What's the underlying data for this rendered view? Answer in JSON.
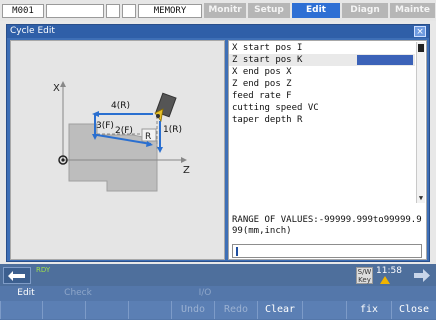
{
  "topbar": {
    "program": "M001",
    "mode": "MEMORY",
    "tabs": [
      {
        "label": "Monitr",
        "active": false
      },
      {
        "label": "Setup",
        "active": false
      },
      {
        "label": "Edit",
        "active": true
      },
      {
        "label": "Diagn",
        "active": false
      },
      {
        "label": "Mainte",
        "active": false
      }
    ]
  },
  "window": {
    "title": "Cycle Edit",
    "close_glyph": "×"
  },
  "diagram": {
    "axis_x": "X",
    "axis_z": "Z",
    "label_4r": "4(R)",
    "label_3f": "3(F)",
    "label_2f": "2(F)",
    "label_1r": "1(R)",
    "label_r": "R"
  },
  "params": [
    {
      "label": "X start pos  I",
      "selected": false
    },
    {
      "label": "Z start pos  K",
      "selected": true
    },
    {
      "label": "X end pos  X",
      "selected": false
    },
    {
      "label": "Z end pos  Z",
      "selected": false
    },
    {
      "label": "feed rate  F",
      "selected": false
    },
    {
      "label": "cutting speed  VC",
      "selected": false
    },
    {
      "label": "taper depth  R",
      "selected": false
    }
  ],
  "range_text": "RANGE OF VALUES:-99999.999to99999.999(mm,inch)",
  "status": {
    "ready": "RDY",
    "sw_key_line1": "S/W",
    "sw_key_line2": "Key",
    "time": "11:58"
  },
  "softkeys": {
    "top_labels": [
      "Edit",
      "Check",
      "I/O"
    ],
    "buttons": [
      "",
      "",
      "",
      "",
      "Undo",
      "Redo",
      "Clear",
      "",
      "fix",
      "Close"
    ],
    "dim": [
      false,
      false,
      false,
      false,
      true,
      true,
      false,
      false,
      false,
      false
    ]
  },
  "colors": {
    "accent": "#2e6fd4",
    "window_bg": "#3e6fb6",
    "status_bg": "#4e6f9c",
    "softkey_bg": "#5477aa"
  }
}
